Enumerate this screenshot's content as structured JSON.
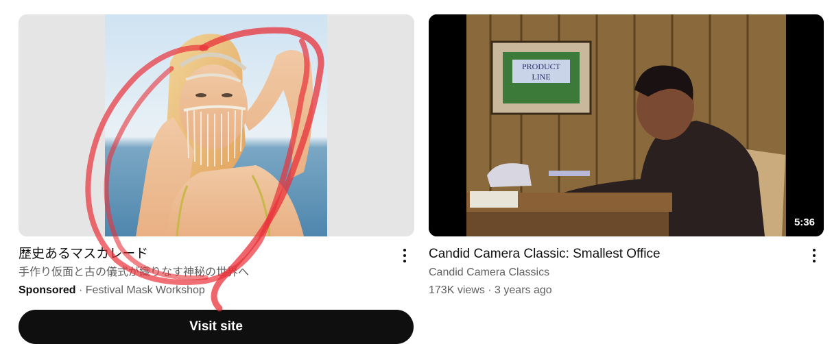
{
  "ad": {
    "title": "歴史あるマスカレード",
    "description": "手作り仮面と古の儀式が織りなす神秘の世界へ",
    "sponsored_label": "Sponsored",
    "separator": " · ",
    "advertiser": "Festival Mask Workshop",
    "cta_label": "Visit site"
  },
  "video": {
    "title": "Candid Camera Classic: Smallest Office",
    "channel": "Candid Camera Classics",
    "views": "173K views",
    "separator": " · ",
    "age": "3 years ago",
    "duration": "5:36",
    "sign_text_line1": "PRODUCT",
    "sign_text_line2": "LINE"
  },
  "colors": {
    "annotation_stroke": "#e8323a",
    "cta_background": "#0f0f0f"
  }
}
